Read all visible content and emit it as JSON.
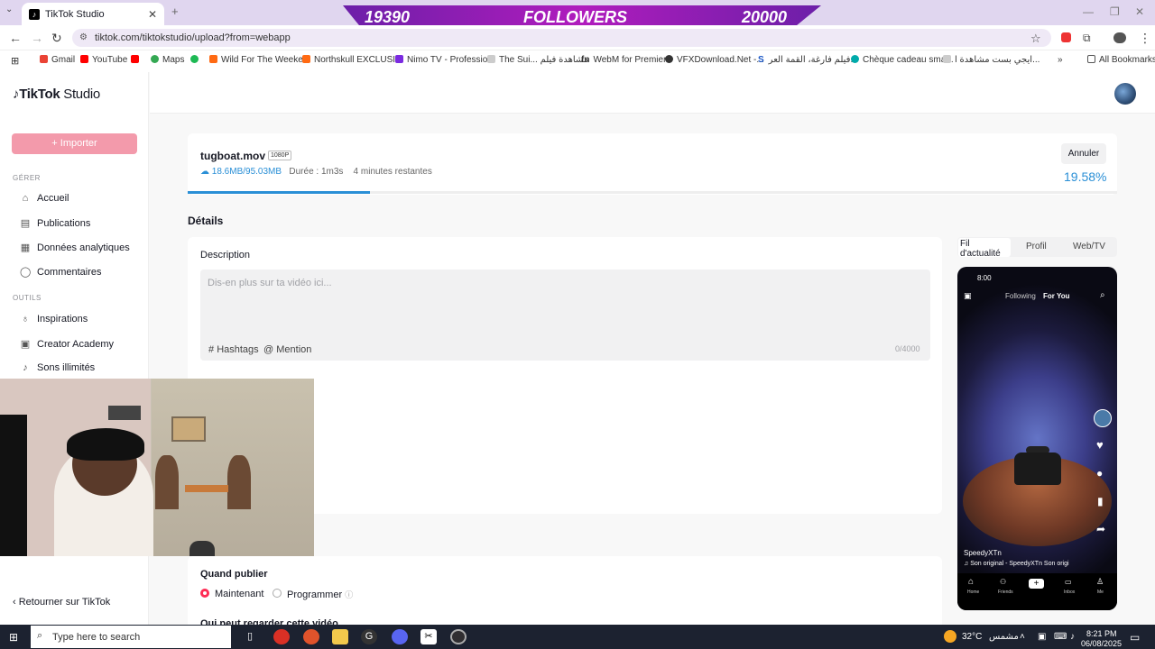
{
  "browser": {
    "tab_title": "TikTok Studio",
    "url": "tiktok.com/tiktokstudio/upload?from=webapp",
    "bookmarks": [
      "Gmail",
      "YouTube",
      "",
      "Maps",
      "",
      "Wild For The Weeke...",
      "Northskull EXCLUSI...",
      "Nimo TV - Professio...",
      "The Sui... مشاهدة فيلم",
      "WebM for Premiere",
      "VFXDownload.Net -...",
      "فيلم فارغة، القمة العر...",
      "Chèque cadeau sma...",
      "ايجي بست مشاهدة ا..."
    ],
    "all_bookmarks": "All Bookmarks"
  },
  "stream_overlay": {
    "current": "19390",
    "label": "FOLLOWERS",
    "goal": "20000"
  },
  "sidebar": {
    "logo": "TikTok",
    "logo_suffix": "Studio",
    "import_button": "+ Importer",
    "section_manage": "GÉRER",
    "manage_items": [
      "Accueil",
      "Publications",
      "Données analytiques",
      "Commentaires"
    ],
    "section_tools": "OUTILS",
    "tool_items": [
      "Inspirations",
      "Creator Academy",
      "Sons illimités"
    ],
    "back_link": "Retourner sur TikTok"
  },
  "upload": {
    "filename": "tugboat.mov",
    "resolution": "1080P",
    "size": "18.6MB/95.03MB",
    "duration": "Durée : 1m3s",
    "remaining": "4 minutes restantes",
    "cancel_button": "Annuler",
    "percent": "19.58%",
    "progress": 0.1958
  },
  "details": {
    "title": "Détails",
    "description_label": "Description",
    "description_placeholder": "Dis-en plus sur ta vidéo ici...",
    "hashtags_button": "Hashtags",
    "mention_button": "Mention",
    "char_count": "0/4000"
  },
  "schedule": {
    "title": "Quand publier",
    "option_now": "Maintenant",
    "option_schedule": "Programmer",
    "who_can_watch": "Qui peut regarder cette vidéo"
  },
  "preview": {
    "tabs": [
      "Fil d'actualité",
      "Profil",
      "Web/TV"
    ],
    "status_time": "8:00",
    "feed_tabs": [
      "Following",
      "For You"
    ],
    "username": "SpeedyXTn",
    "sound": "Son original - SpeedyXTn    Son origi",
    "nav": [
      "Home",
      "Friends",
      "",
      "Inbox",
      "Me"
    ]
  },
  "taskbar": {
    "search_placeholder": "Type here to search",
    "weather": "32°C",
    "weather_text": "مشمس",
    "time": "8:21 PM",
    "date": "06/08/2025"
  },
  "colors": {
    "accent": "#fe2c55",
    "progress": "#2a8fd6",
    "import": "#f39aab"
  }
}
